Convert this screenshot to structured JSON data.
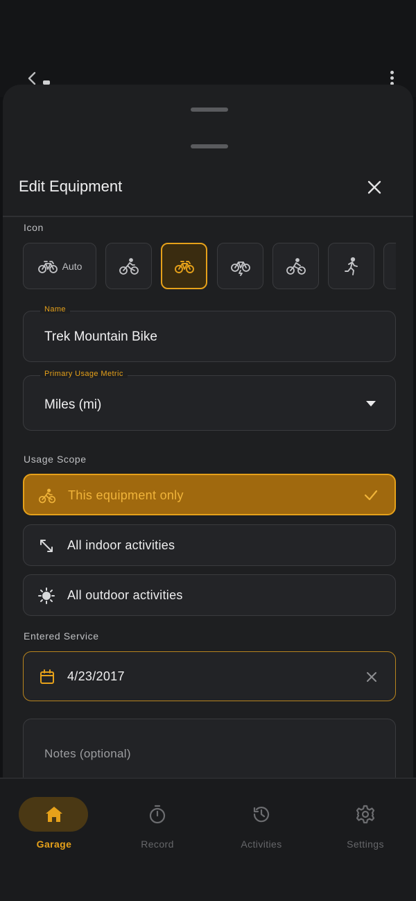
{
  "sheet": {
    "title": "Edit Equipment"
  },
  "icon_section": {
    "label": "Icon",
    "auto_label": "Auto",
    "options": [
      {
        "icon": "bike-auto-icon",
        "selected": false
      },
      {
        "icon": "cyclist-icon",
        "selected": false
      },
      {
        "icon": "bike-icon",
        "selected": true
      },
      {
        "icon": "ebike-icon",
        "selected": false
      },
      {
        "icon": "cyclist-road-icon",
        "selected": false
      },
      {
        "icon": "runner-icon",
        "selected": false
      }
    ]
  },
  "name_field": {
    "label": "Name",
    "value": "Trek Mountain Bike"
  },
  "metric_field": {
    "label": "Primary Usage Metric",
    "value": "Miles (mi)"
  },
  "usage_scope": {
    "label": "Usage Scope",
    "options": [
      {
        "label": "This equipment only",
        "icon": "bike-icon",
        "selected": true
      },
      {
        "label": "All indoor activities",
        "icon": "arrows-diagonal-icon",
        "selected": false
      },
      {
        "label": "All outdoor activities",
        "icon": "sun-icon",
        "selected": false
      }
    ]
  },
  "entered_service": {
    "label": "Entered Service",
    "value": "4/23/2017"
  },
  "notes": {
    "placeholder": "Notes (optional)"
  },
  "bottom_nav": {
    "items": [
      {
        "label": "Garage",
        "icon": "home-icon",
        "active": true
      },
      {
        "label": "Record",
        "icon": "stopwatch-icon",
        "active": false
      },
      {
        "label": "Activities",
        "icon": "history-icon",
        "active": false
      },
      {
        "label": "Settings",
        "icon": "gear-icon",
        "active": false
      }
    ]
  },
  "colors": {
    "accent": "#e6a11a",
    "sheet_bg": "#1e1f21",
    "selected_option_bg": "#a0690e"
  }
}
